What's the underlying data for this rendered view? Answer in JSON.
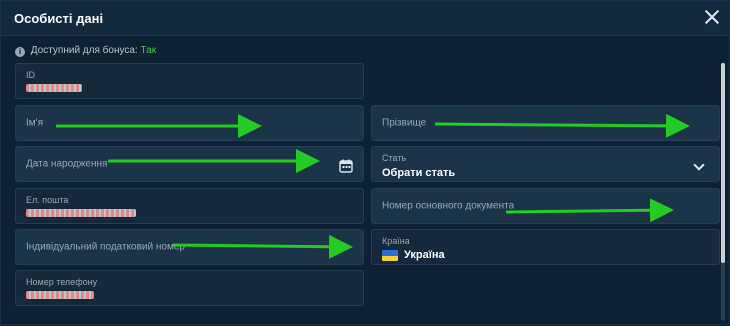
{
  "dialog": {
    "title": "Особисті дані"
  },
  "bonus": {
    "label": "Доступний для бонуса:",
    "value": "Так"
  },
  "fields": {
    "id": {
      "label": "ID"
    },
    "first_name": {
      "label": "Ім'я"
    },
    "last_name": {
      "label": "Прізвище"
    },
    "birth_date": {
      "label": "Дата народження"
    },
    "gender": {
      "label": "Стать",
      "value": "Обрати стать"
    },
    "email": {
      "label": "Ел. пошта"
    },
    "document": {
      "label": "Номер основного документа"
    },
    "tax_id": {
      "label": "Індивідуальний податковий номер"
    },
    "country": {
      "label": "Країна",
      "value": "Україна"
    },
    "phone": {
      "label": "Номер телефону"
    }
  },
  "colors": {
    "arrow": "#22cc22",
    "accent": "#44c653"
  }
}
